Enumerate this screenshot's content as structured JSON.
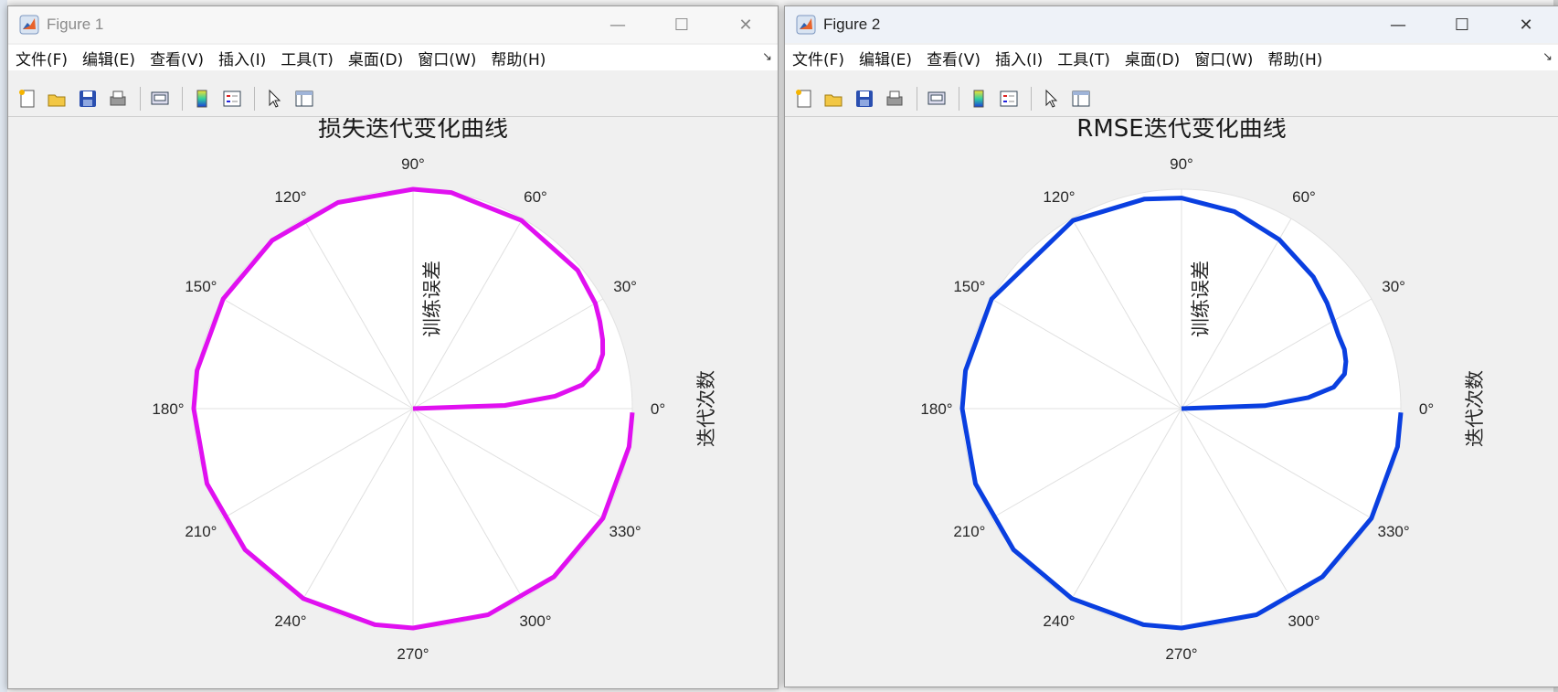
{
  "windows": [
    {
      "title": "Figure 1",
      "active": false,
      "menu": [
        "文件(F)",
        "编辑(E)",
        "查看(V)",
        "插入(I)",
        "工具(T)",
        "桌面(D)",
        "窗口(W)",
        "帮助(H)"
      ],
      "chart": {
        "title": "损失迭代变化曲线",
        "rlabel": "训练误差",
        "thetalabel": "迭代次数",
        "angle_ticks": [
          "0°",
          "30°",
          "60°",
          "90°",
          "120°",
          "150°",
          "180°",
          "210°",
          "240°",
          "270°",
          "300°",
          "330°"
        ],
        "color": "#E010F0"
      }
    },
    {
      "title": "Figure 2",
      "active": true,
      "menu": [
        "文件(F)",
        "编辑(E)",
        "查看(V)",
        "插入(I)",
        "工具(T)",
        "桌面(D)",
        "窗口(W)",
        "帮助(H)"
      ],
      "chart": {
        "title": "RMSE迭代变化曲线",
        "rlabel": "训练误差",
        "thetalabel": "迭代次数",
        "angle_ticks": [
          "0°",
          "30°",
          "60°",
          "90°",
          "120°",
          "150°",
          "180°",
          "210°",
          "240°",
          "270°",
          "300°",
          "330°"
        ],
        "color": "#0A3FE0"
      }
    }
  ],
  "toolbar_icons": [
    "new-figure-icon",
    "open-file-icon",
    "save-icon",
    "print-icon",
    "print-preview-icon",
    "colorbar-icon",
    "legend-icon",
    "edit-plot-icon",
    "property-inspector-icon"
  ],
  "chart_data": [
    {
      "type": "polar-line",
      "title": "损失迭代变化曲线",
      "theta_label": "迭代次数",
      "r_label": "训练误差",
      "theta_ticks_deg": [
        0,
        30,
        60,
        90,
        120,
        150,
        180,
        210,
        240,
        270,
        300,
        330
      ],
      "rlim": [
        0,
        1
      ],
      "theta_deg": [
        0,
        2,
        5,
        8,
        12,
        16,
        20,
        25,
        30,
        40,
        60,
        80,
        90,
        110,
        130,
        150,
        170,
        180,
        200,
        220,
        240,
        260,
        270,
        290,
        310,
        330,
        350,
        359
      ],
      "r": [
        0.0,
        0.42,
        0.65,
        0.78,
        0.86,
        0.9,
        0.92,
        0.94,
        0.96,
        0.98,
        0.99,
        1.0,
        1.0,
        1.0,
        1.0,
        1.0,
        1.0,
        1.0,
        1.0,
        1.0,
        1.0,
        1.0,
        1.0,
        1.0,
        1.0,
        1.0,
        1.0,
        1.0
      ],
      "color": "#E010F0",
      "grid": true
    },
    {
      "type": "polar-line",
      "title": "RMSE迭代变化曲线",
      "theta_label": "迭代次数",
      "r_label": "训练误差",
      "theta_ticks_deg": [
        0,
        30,
        60,
        90,
        120,
        150,
        180,
        210,
        240,
        270,
        300,
        330
      ],
      "rlim": [
        0,
        1
      ],
      "theta_deg": [
        0,
        2,
        5,
        8,
        12,
        16,
        20,
        25,
        30,
        36,
        45,
        60,
        75,
        90,
        100,
        120,
        150,
        170,
        180,
        200,
        220,
        240,
        260,
        270,
        290,
        310,
        330,
        350,
        359
      ],
      "r": [
        0.0,
        0.38,
        0.58,
        0.7,
        0.76,
        0.78,
        0.79,
        0.79,
        0.8,
        0.82,
        0.85,
        0.89,
        0.93,
        0.96,
        0.97,
        0.99,
        1.0,
        1.0,
        1.0,
        1.0,
        1.0,
        1.0,
        1.0,
        1.0,
        1.0,
        1.0,
        1.0,
        1.0,
        1.0
      ],
      "color": "#0A3FE0",
      "grid": true
    }
  ]
}
